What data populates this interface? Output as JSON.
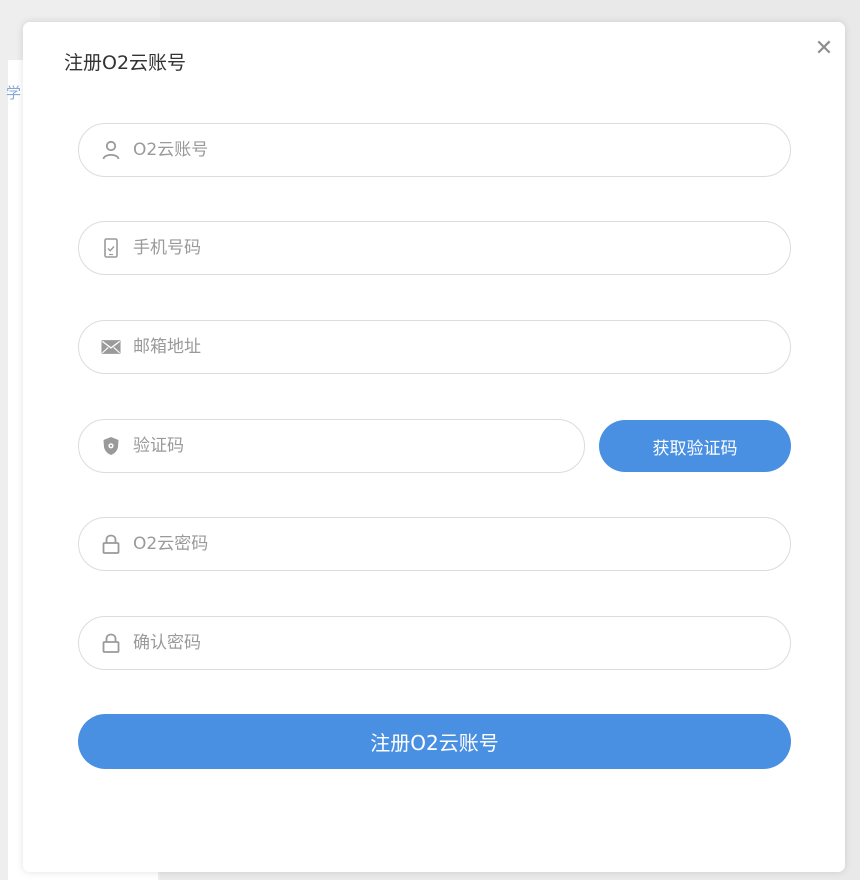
{
  "background": {
    "fragment_text": "学"
  },
  "dialog": {
    "title": "注册O2云账号",
    "close_glyph": "✕"
  },
  "form": {
    "account": {
      "placeholder": "O2云账号",
      "icon": "user-icon",
      "value": ""
    },
    "phone": {
      "placeholder": "手机号码",
      "icon": "mobile-phone-icon",
      "value": ""
    },
    "email": {
      "placeholder": "邮箱地址",
      "icon": "envelope-icon",
      "value": ""
    },
    "code": {
      "placeholder": "验证码",
      "icon": "shield-icon",
      "value": ""
    },
    "get_code_label": "获取验证码",
    "password": {
      "placeholder": "O2云密码",
      "icon": "lock-icon",
      "value": ""
    },
    "confirm_password": {
      "placeholder": "确认密码",
      "icon": "lock-icon",
      "value": ""
    },
    "submit_label": "注册O2云账号"
  },
  "colors": {
    "accent": "#4a90e2",
    "icon_gray": "#9a9a9a",
    "border": "#dcdcdc",
    "title_text": "#333333"
  }
}
